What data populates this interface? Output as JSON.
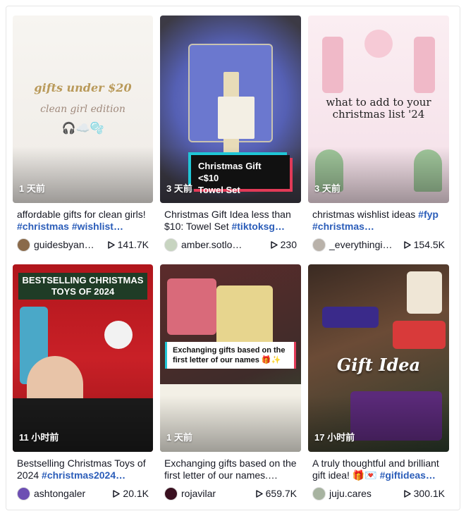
{
  "videos": [
    {
      "overlay": [
        "gifts under $20",
        "clean girl edition",
        "🎧☁️🫧"
      ],
      "time": "1 天前",
      "desc_text": "affordable gifts for clean girls! ",
      "tags": "#christmas #wishlist…",
      "author": "guidesbyan…",
      "views": "141.7K",
      "avatar_color": "#8a6a4a"
    },
    {
      "overlay": [
        "Christmas Gift <$10",
        "Towel Set"
      ],
      "time": "3 天前",
      "desc_text": "Christmas Gift Idea less than $10: Towel Set ",
      "tags": "#tiktoksg…",
      "author": "amber.sotlo…",
      "views": "230",
      "avatar_color": "#c7d4c0"
    },
    {
      "overlay": [
        "what to add to your",
        "christmas list '24"
      ],
      "time": "3 天前",
      "desc_text": "christmas wishlist ideas ",
      "tags": "#fyp #christmas…",
      "author": "_everythingi…",
      "views": "154.5K",
      "avatar_color": "#b9b2aa"
    },
    {
      "overlay": [
        "BESTSELLING CHRISTMAS",
        "TOYS OF 2024"
      ],
      "time": "11 小时前",
      "desc_text": "Bestselling Christmas Toys of 2024 ",
      "tags": "#christmas2024…",
      "author": "ashtongaler",
      "views": "20.1K",
      "avatar_color": "#6d4fb3"
    },
    {
      "overlay": [
        "Exchanging gifts based on the",
        "first letter of our names 🎁✨"
      ],
      "time": "1 天前",
      "desc_text": "Exchanging gifts based on the first letter of our names.…",
      "tags": "",
      "author": "rojavilar",
      "views": "659.7K",
      "avatar_color": "#3a1020"
    },
    {
      "overlay": [
        "Gift Idea"
      ],
      "time": "17 小时前",
      "desc_text": "A truly thoughtful and brilliant gift idea! 🎁💌 ",
      "tags": "#giftideas…",
      "author": "juju.cares",
      "views": "300.1K",
      "avatar_color": "#a7b3a0"
    }
  ],
  "icons": {
    "views": "play-icon"
  }
}
